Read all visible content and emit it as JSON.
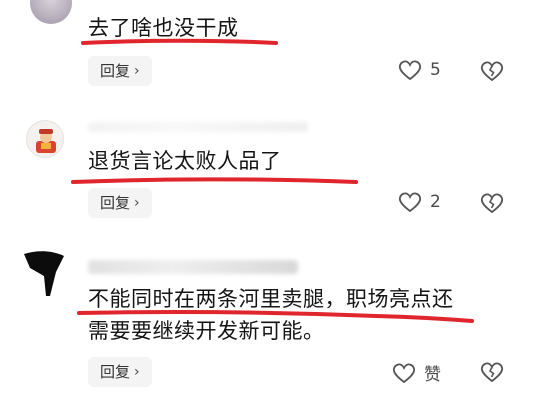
{
  "comments": [
    {
      "text": "去了啥也没干成",
      "reply_label": "回复",
      "like_count": "5"
    },
    {
      "text": "退货言论太败人品了",
      "reply_label": "回复",
      "like_count": "2"
    },
    {
      "text_line1": "不能同时在两条河里卖腿，职场亮点还",
      "text_line2": "需要要继续开发新可能。",
      "reply_label": "回复",
      "like_label": "赞"
    }
  ],
  "colors": {
    "underline": "#e0262d",
    "reply_bg": "#f4f4f5",
    "text": "#141414"
  },
  "icons": {
    "reply": "chevron-right-icon",
    "like": "heart-outline-icon",
    "dislike": "broken-heart-icon"
  }
}
